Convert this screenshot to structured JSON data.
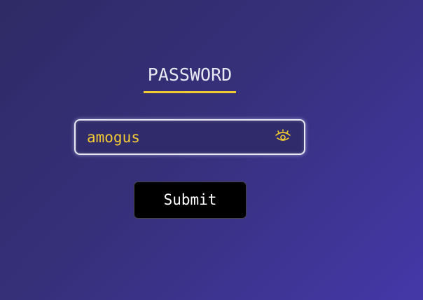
{
  "form": {
    "title": "PASSWORD",
    "password_value": "amogus",
    "reveal_icon": "eye-icon",
    "submit_label": "Submit"
  },
  "colors": {
    "accent": "#f3c933",
    "field_border": "#e9e7f1",
    "button_bg": "#000000"
  }
}
